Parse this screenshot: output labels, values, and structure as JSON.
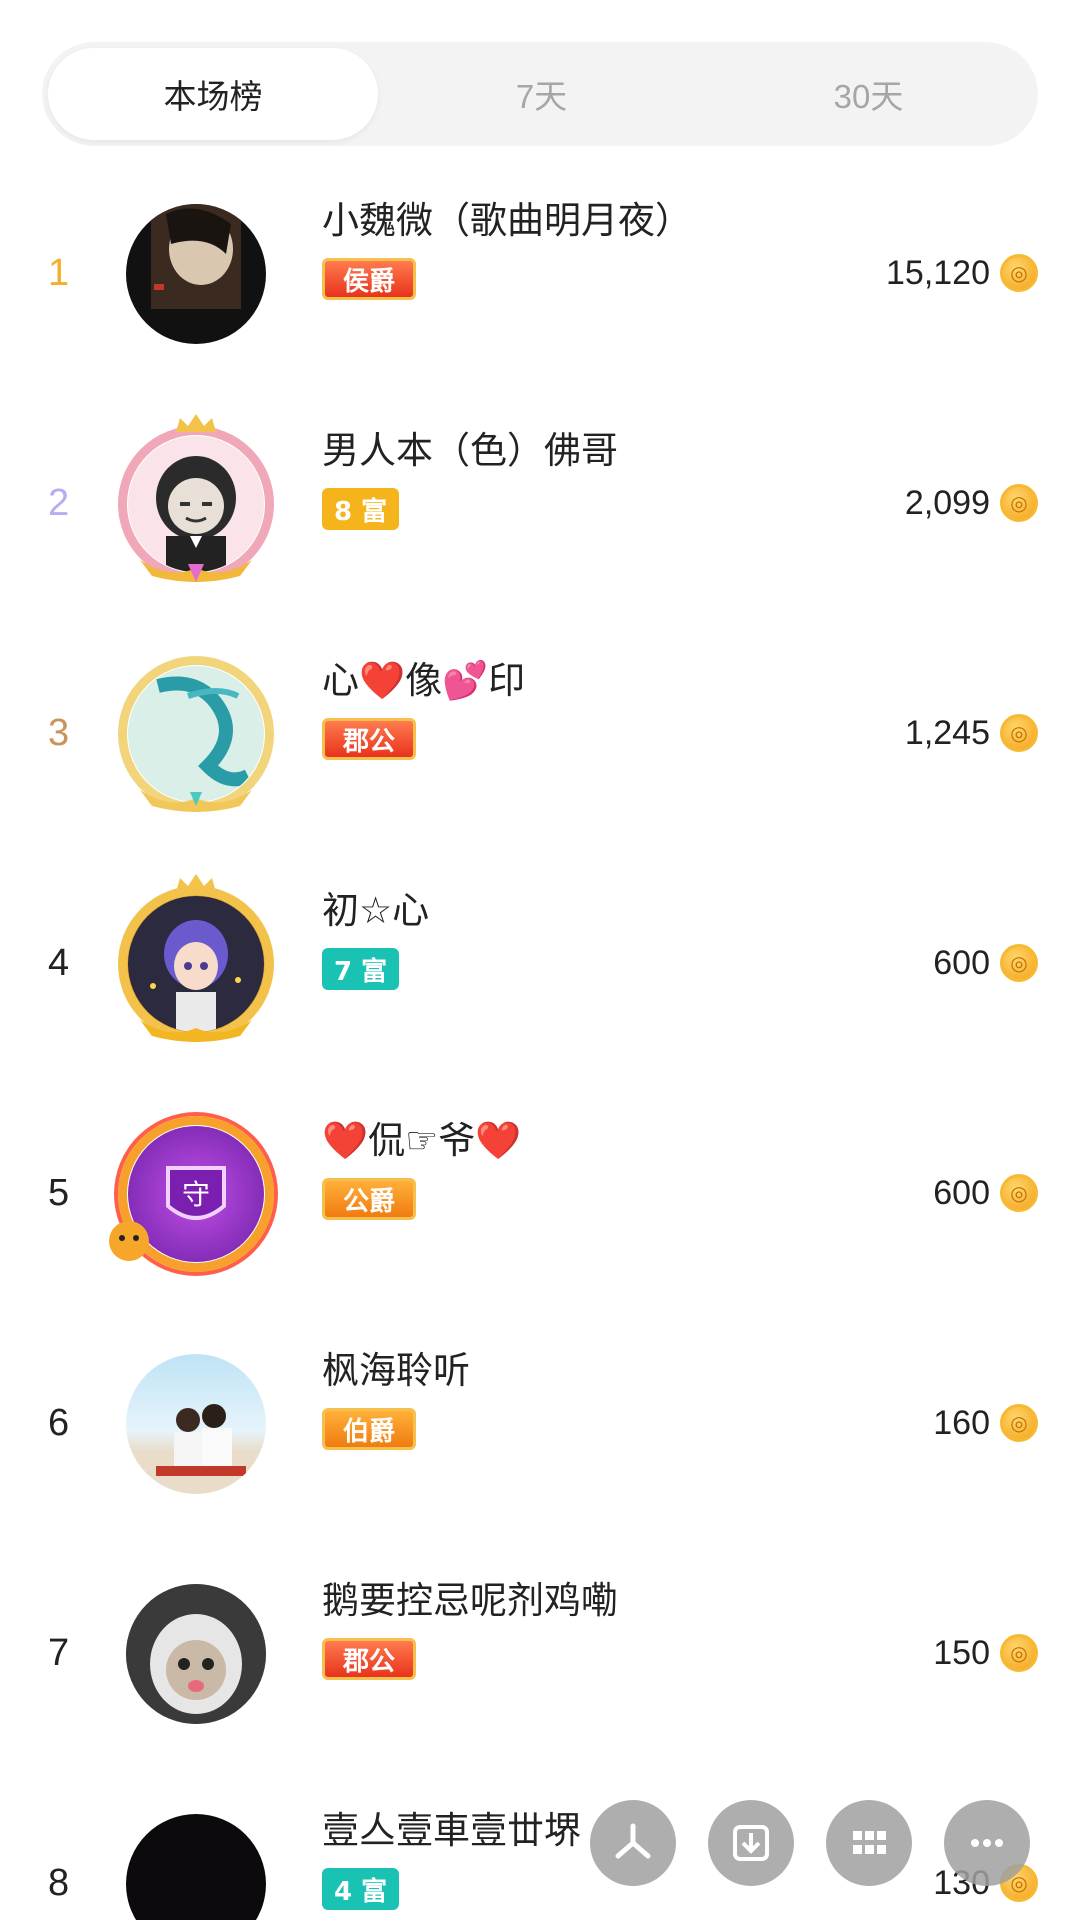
{
  "tabs": [
    {
      "label": "本场榜",
      "active": true
    },
    {
      "label": "7天",
      "active": false
    },
    {
      "label": "30天",
      "active": false
    }
  ],
  "accent": {
    "coin": "#f3a21a",
    "rank1": "#f0b12a",
    "rank2": "#b4aef0",
    "rank3": "#c9935a"
  },
  "rows": [
    {
      "rank": "1",
      "name": "小魏微（歌曲明月夜）",
      "badge": "侯爵",
      "badge_type": "noble",
      "score": "15,120"
    },
    {
      "rank": "2",
      "name": "男人本（色）佛哥",
      "badge": "8 富",
      "badge_type": "rich-gold",
      "score": "2,099"
    },
    {
      "rank": "3",
      "name": "心❤️像💕印",
      "badge": "郡公",
      "badge_type": "noble",
      "score": "1,245"
    },
    {
      "rank": "4",
      "name": "初☆心",
      "badge": "7 富",
      "badge_type": "rich-teal",
      "score": "600"
    },
    {
      "rank": "5",
      "name": "❤️侃☞爷❤️",
      "badge": "公爵",
      "badge_type": "noble-orange",
      "score": "600"
    },
    {
      "rank": "6",
      "name": "枫海聆听",
      "badge": "伯爵",
      "badge_type": "noble-orange",
      "score": "160"
    },
    {
      "rank": "7",
      "name": "鹅要控忌呢剂鸡嘞",
      "badge": "郡公",
      "badge_type": "noble",
      "score": "150"
    },
    {
      "rank": "8",
      "name": "壹亼壹車壹丗堺",
      "badge": "4 富",
      "badge_type": "rich-teal",
      "score": "130"
    }
  ],
  "coin_icon": "coin-icon",
  "float_buttons": [
    "pinwheel-icon",
    "download-icon",
    "grid-icon",
    "more-icon"
  ]
}
